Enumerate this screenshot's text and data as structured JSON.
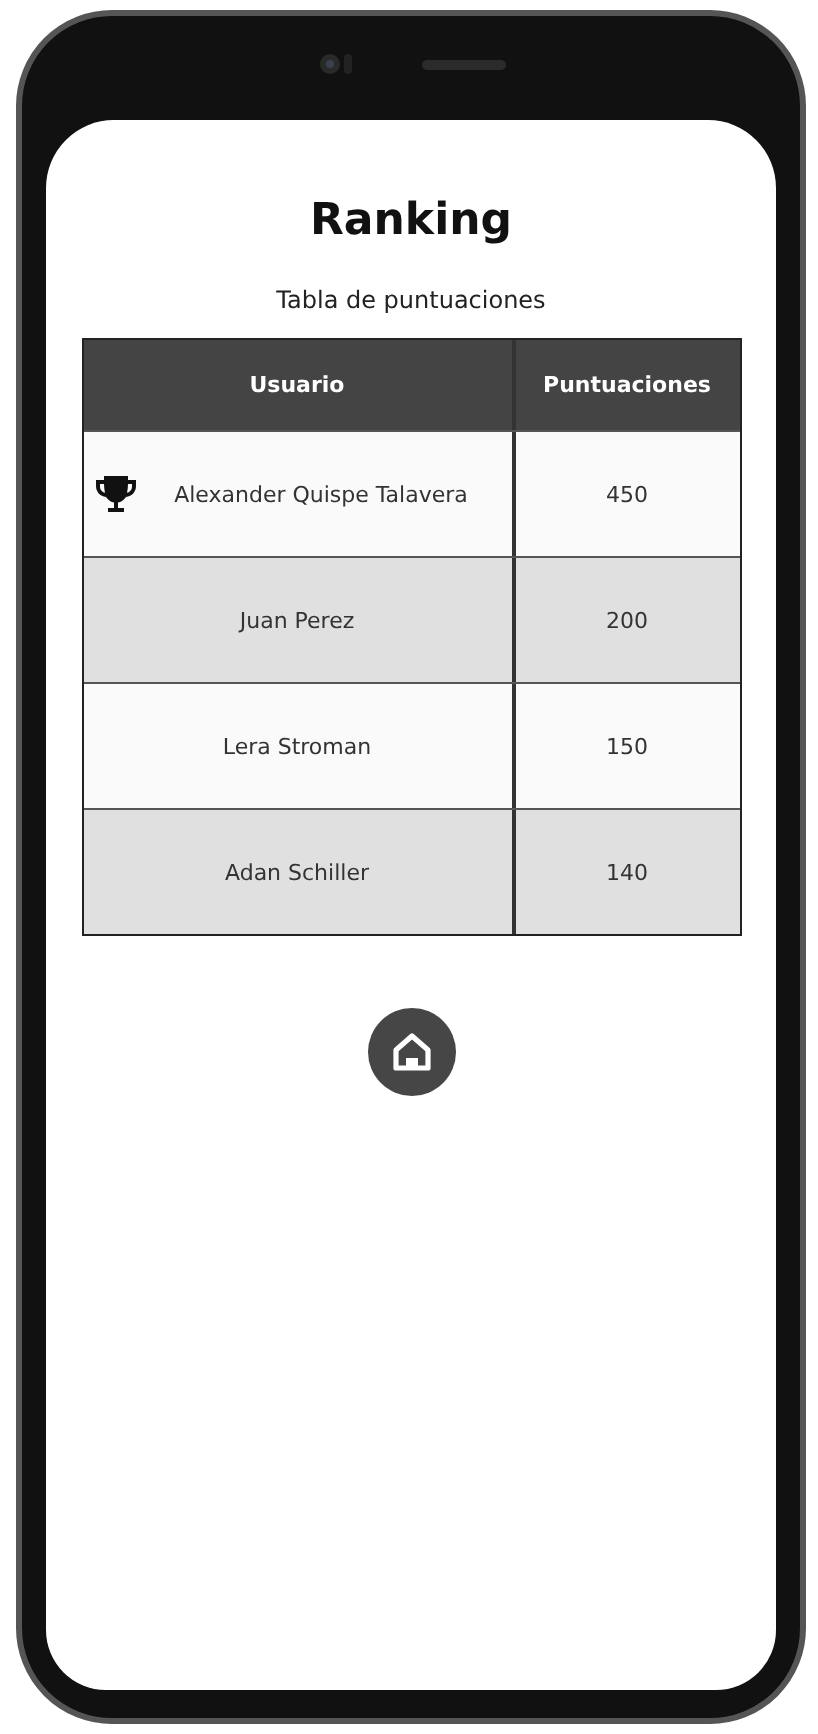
{
  "title": "Ranking",
  "subtitle": "Tabla de puntuaciones",
  "table": {
    "columns": [
      "Usuario",
      "Puntuaciones"
    ],
    "rows": [
      {
        "user": "Alexander Quispe Talavera",
        "score": "450",
        "trophy": true
      },
      {
        "user": "Juan Perez",
        "score": "200",
        "trophy": false
      },
      {
        "user": "Lera Stroman",
        "score": "150",
        "trophy": false
      },
      {
        "user": "Adan Schiller",
        "score": "140",
        "trophy": false
      }
    ]
  }
}
